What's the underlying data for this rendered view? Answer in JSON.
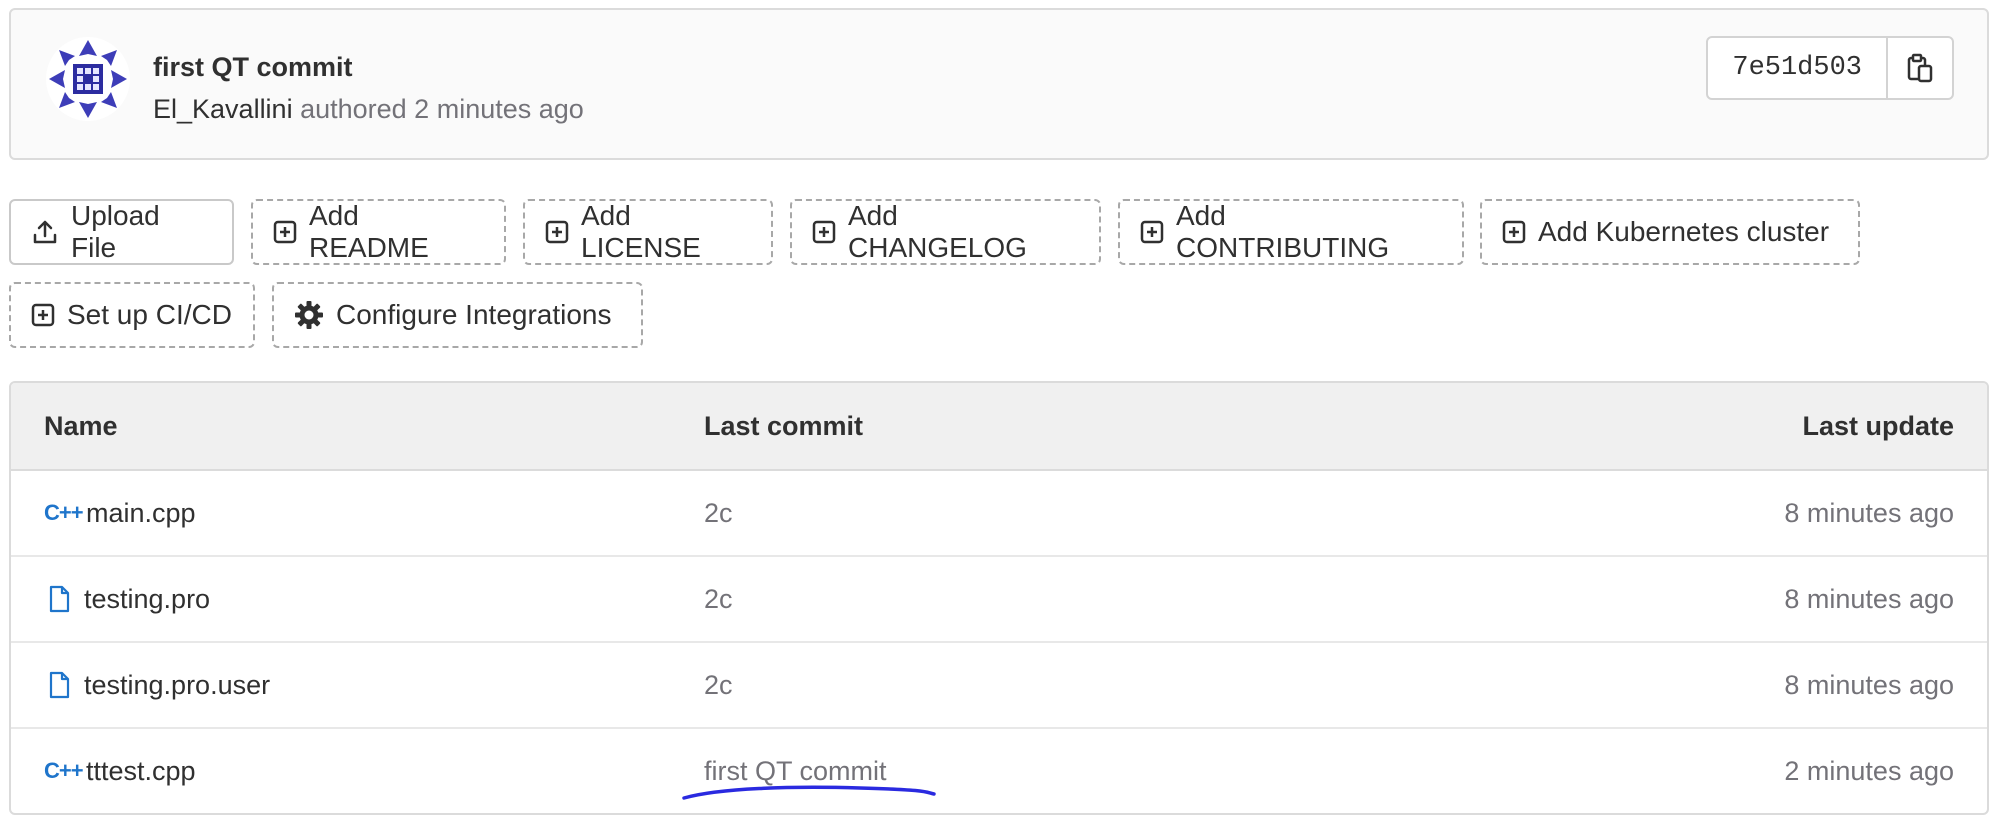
{
  "commit": {
    "title": "first QT commit",
    "author": "El_Kavallini",
    "authored_text": "authored 2 minutes ago",
    "sha": "7e51d503"
  },
  "actions": {
    "upload_file": "Upload File",
    "add_readme": "Add README",
    "add_license": "Add LICENSE",
    "add_changelog": "Add CHANGELOG",
    "add_contributing": "Add CONTRIBUTING",
    "add_kubernetes": "Add Kubernetes cluster",
    "setup_cicd": "Set up CI/CD",
    "configure_integrations": "Configure Integrations"
  },
  "table": {
    "headers": {
      "name": "Name",
      "last_commit": "Last commit",
      "last_update": "Last update"
    },
    "rows": [
      {
        "icon": "cpp-file-icon",
        "name": "main.cpp",
        "last_commit": "2c",
        "last_update": "8 minutes ago"
      },
      {
        "icon": "file-icon",
        "name": "testing.pro",
        "last_commit": "2c",
        "last_update": "8 minutes ago"
      },
      {
        "icon": "file-icon",
        "name": "testing.pro.user",
        "last_commit": "2c",
        "last_update": "8 minutes ago"
      },
      {
        "icon": "cpp-file-icon",
        "name": "tttest.cpp",
        "last_commit": "first QT commit",
        "last_update": "2 minutes ago"
      }
    ]
  },
  "colors": {
    "accent": "#1f75cb",
    "annotation": "#2a2ae0",
    "muted": "#737278"
  }
}
